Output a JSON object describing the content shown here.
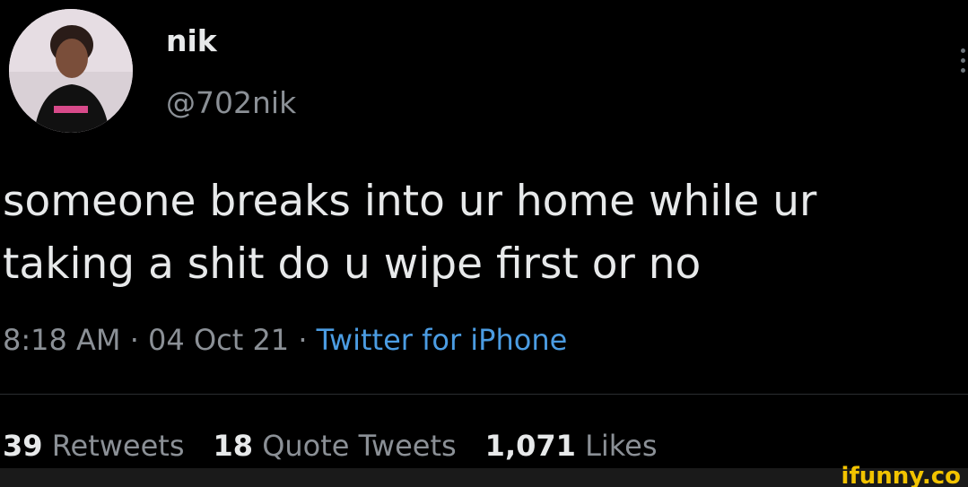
{
  "tweet": {
    "author": {
      "display_name": "nik",
      "handle": "@702nik",
      "avatar_icon": "avatar-photo"
    },
    "text_lines": [
      "someone breaks into ur home while ur",
      "taking a shit do u wipe first or no"
    ],
    "time": "8:18 AM",
    "separator": "·",
    "date": "04 Oct 21",
    "source": "Twitter for iPhone",
    "stats": {
      "retweets_count": "39",
      "retweets_label": "Retweets",
      "quotes_count": "18",
      "quotes_label": "Quote Tweets",
      "likes_count": "1,071",
      "likes_label": "Likes"
    }
  },
  "watermark": "ifunny.co",
  "colors": {
    "background": "#000000",
    "text": "#e7e9ea",
    "muted": "#8b9096",
    "link": "#4b9ce2",
    "watermark": "#f2c300"
  }
}
